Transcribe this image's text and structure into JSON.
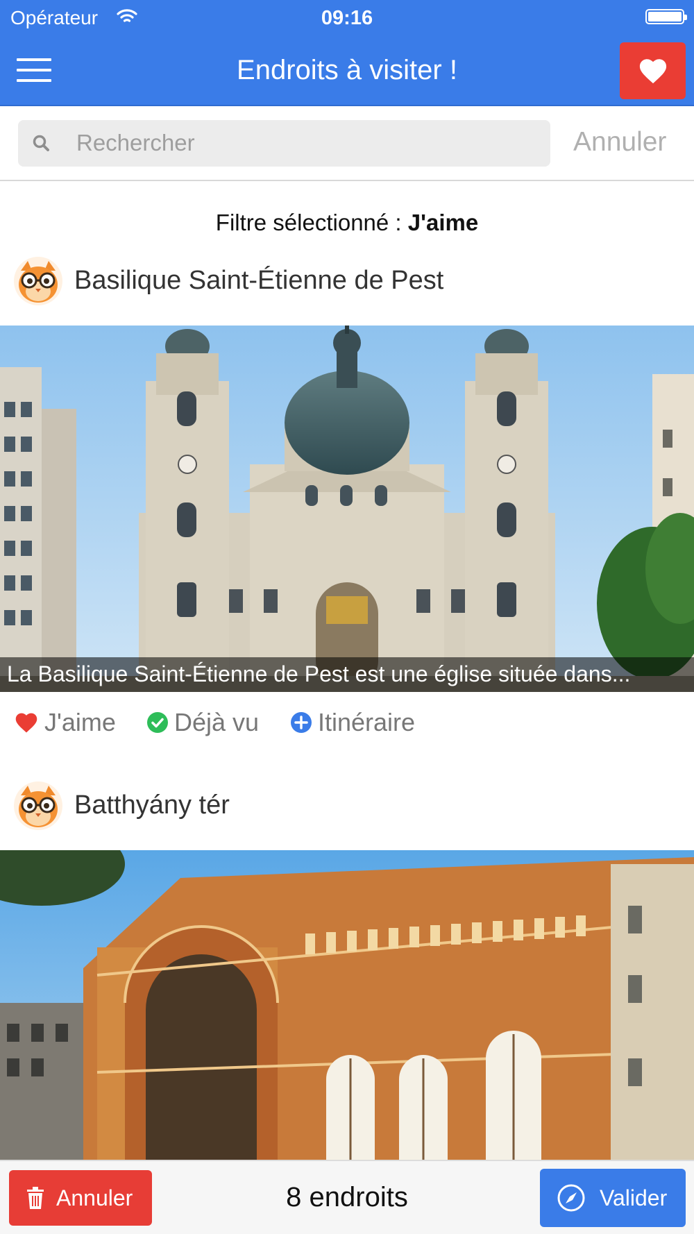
{
  "status_bar": {
    "carrier": "Opérateur",
    "time": "09:16"
  },
  "header": {
    "title": "Endroits à visiter !",
    "menu_icon": "hamburger-icon",
    "favorite_icon": "heart-icon"
  },
  "search": {
    "placeholder": "Rechercher",
    "value": "",
    "cancel_label": "Annuler"
  },
  "filter": {
    "prefix": "Filtre sélectionné : ",
    "value": "J'aime"
  },
  "places": [
    {
      "name": "Basilique Saint-Étienne de Pest",
      "caption": "La Basilique Saint-Étienne de Pest est une église située dans...",
      "actions": {
        "like": "J'aime",
        "seen": "Déjà vu",
        "itinerary": "Itinéraire"
      }
    },
    {
      "name": "Batthyány tér"
    }
  ],
  "footer": {
    "cancel_label": "Annuler",
    "count": "8 endroits",
    "validate_label": "Valider"
  },
  "colors": {
    "primary": "#3a7ce8",
    "danger": "#ea3d34",
    "success": "#2ebd59"
  }
}
